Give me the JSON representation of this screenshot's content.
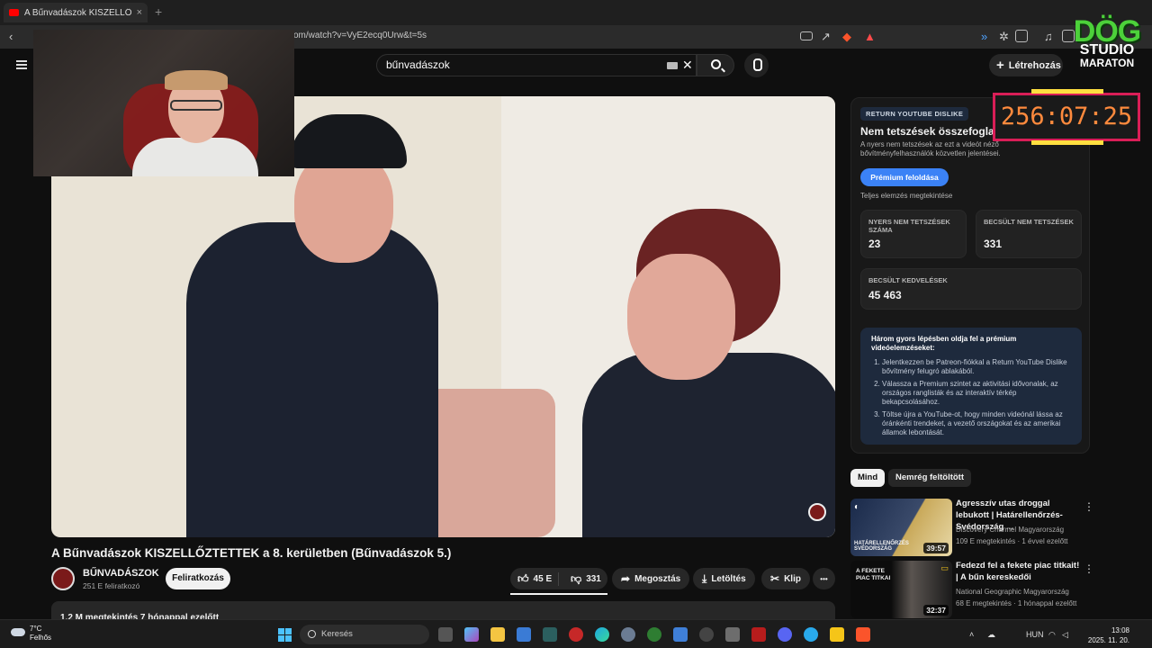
{
  "browser": {
    "tab_title": "A Bűnvadászok KISZELLŐZTETTEK",
    "tab_close": "×",
    "new_tab": "+",
    "url": "om/watch?v=VyE2ecq0Urw&t=5s"
  },
  "header": {
    "search_value": "bűnvadászok",
    "create_label": "Létrehozás"
  },
  "overlay": {
    "logo_line1": "DÖG",
    "logo_line2": "STUDIO",
    "logo_line3": "MARATON",
    "timer": "256:07:25"
  },
  "video": {
    "title": "A Bűnvadászok KISZELLŐZTETTEK a 8. kerületben (Bűnvadászok 5.)",
    "channel": "BŰNVADÁSZOK",
    "subscribers": "251 E feliratkozó",
    "subscribe_label": "Feliratkozás",
    "likes": "45 E",
    "dislikes": "331",
    "share_label": "Megosztás",
    "download_label": "Letöltés",
    "clip_label": "Klip",
    "more_label": "•••",
    "description_preview": "1,2 M megtekintés  7 hónappal ezelőtt"
  },
  "dislike_panel": {
    "tag": "RETURN YOUTUBE DISLIKE",
    "heading": "Nem tetszések összefoglalója",
    "subtitle": "A nyers nem tetszések az ezt a videót néző bővítményfelhasználók közvetlen jelentései.",
    "premium_button": "Prémium feloldása",
    "full_analysis": "Teljes elemzés megtekintése",
    "raw_label": "NYERS NEM TETSZÉSEK SZÁMA",
    "raw_value": "23",
    "est_dislike_label": "BECSÜLT NEM TETSZÉSEK",
    "est_dislike_value": "331",
    "est_like_label": "BECSÜLT KEDVELÉSEK",
    "est_like_value": "45 463",
    "steps_heading": "Három gyors lépésben oldja fel a prémium videóelemzéseket:",
    "steps": [
      "Jelentkezzen be Patreon-fiókkal a Return YouTube Dislike bővítmény felugró ablakából.",
      "Válassza a Premium szintet az aktivitási idővonalak, az országos ranglisták és az interaktív térkép bekapcsolásához.",
      "Töltse újra a YouTube-ot, hogy minden videónál lássa az óránkénti trendeket, a vezető országokat és az amerikai államok lebontását."
    ]
  },
  "filters": {
    "all": "Mind",
    "recent": "Nemrég feltöltött"
  },
  "recommended": [
    {
      "title": "Agresszív utas droggal lebukott | Határellenőrzés-Svédország ...",
      "channel": "Discovery Channel Magyarország",
      "meta": "109 E megtekintés · 1 évvel ezelőtt",
      "duration": "39:57",
      "thumb_caption": "HATÁRELLENŐRZÉS SVÉDORSZÁG"
    },
    {
      "title": "Fedezd fel a fekete piac titkait! | A bűn kereskedői",
      "channel": "National Geographic Magyarország",
      "meta": "68 E megtekintés · 1 hónappal ezelőtt",
      "duration": "32:37",
      "thumb_caption": "A FEKETE PIAC TITKAI"
    }
  ],
  "taskbar": {
    "temp": "7°C",
    "weather": "Felhős",
    "search_label": "Keresés",
    "lang": "HUN",
    "time": "13:08",
    "date": "2025. 11. 20."
  }
}
